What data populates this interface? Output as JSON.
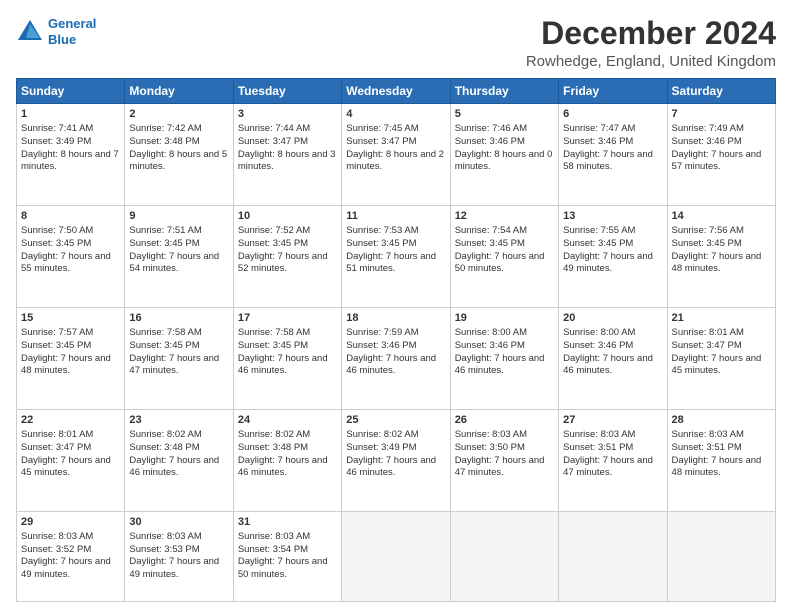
{
  "logo": {
    "line1": "General",
    "line2": "Blue"
  },
  "title": "December 2024",
  "subtitle": "Rowhedge, England, United Kingdom",
  "days": [
    "Sunday",
    "Monday",
    "Tuesday",
    "Wednesday",
    "Thursday",
    "Friday",
    "Saturday"
  ],
  "weeks": [
    [
      {
        "day": "1",
        "sunrise": "Sunrise: 7:41 AM",
        "sunset": "Sunset: 3:49 PM",
        "daylight": "Daylight: 8 hours and 7 minutes."
      },
      {
        "day": "2",
        "sunrise": "Sunrise: 7:42 AM",
        "sunset": "Sunset: 3:48 PM",
        "daylight": "Daylight: 8 hours and 5 minutes."
      },
      {
        "day": "3",
        "sunrise": "Sunrise: 7:44 AM",
        "sunset": "Sunset: 3:47 PM",
        "daylight": "Daylight: 8 hours and 3 minutes."
      },
      {
        "day": "4",
        "sunrise": "Sunrise: 7:45 AM",
        "sunset": "Sunset: 3:47 PM",
        "daylight": "Daylight: 8 hours and 2 minutes."
      },
      {
        "day": "5",
        "sunrise": "Sunrise: 7:46 AM",
        "sunset": "Sunset: 3:46 PM",
        "daylight": "Daylight: 8 hours and 0 minutes."
      },
      {
        "day": "6",
        "sunrise": "Sunrise: 7:47 AM",
        "sunset": "Sunset: 3:46 PM",
        "daylight": "Daylight: 7 hours and 58 minutes."
      },
      {
        "day": "7",
        "sunrise": "Sunrise: 7:49 AM",
        "sunset": "Sunset: 3:46 PM",
        "daylight": "Daylight: 7 hours and 57 minutes."
      }
    ],
    [
      {
        "day": "8",
        "sunrise": "Sunrise: 7:50 AM",
        "sunset": "Sunset: 3:45 PM",
        "daylight": "Daylight: 7 hours and 55 minutes."
      },
      {
        "day": "9",
        "sunrise": "Sunrise: 7:51 AM",
        "sunset": "Sunset: 3:45 PM",
        "daylight": "Daylight: 7 hours and 54 minutes."
      },
      {
        "day": "10",
        "sunrise": "Sunrise: 7:52 AM",
        "sunset": "Sunset: 3:45 PM",
        "daylight": "Daylight: 7 hours and 52 minutes."
      },
      {
        "day": "11",
        "sunrise": "Sunrise: 7:53 AM",
        "sunset": "Sunset: 3:45 PM",
        "daylight": "Daylight: 7 hours and 51 minutes."
      },
      {
        "day": "12",
        "sunrise": "Sunrise: 7:54 AM",
        "sunset": "Sunset: 3:45 PM",
        "daylight": "Daylight: 7 hours and 50 minutes."
      },
      {
        "day": "13",
        "sunrise": "Sunrise: 7:55 AM",
        "sunset": "Sunset: 3:45 PM",
        "daylight": "Daylight: 7 hours and 49 minutes."
      },
      {
        "day": "14",
        "sunrise": "Sunrise: 7:56 AM",
        "sunset": "Sunset: 3:45 PM",
        "daylight": "Daylight: 7 hours and 48 minutes."
      }
    ],
    [
      {
        "day": "15",
        "sunrise": "Sunrise: 7:57 AM",
        "sunset": "Sunset: 3:45 PM",
        "daylight": "Daylight: 7 hours and 48 minutes."
      },
      {
        "day": "16",
        "sunrise": "Sunrise: 7:58 AM",
        "sunset": "Sunset: 3:45 PM",
        "daylight": "Daylight: 7 hours and 47 minutes."
      },
      {
        "day": "17",
        "sunrise": "Sunrise: 7:58 AM",
        "sunset": "Sunset: 3:45 PM",
        "daylight": "Daylight: 7 hours and 46 minutes."
      },
      {
        "day": "18",
        "sunrise": "Sunrise: 7:59 AM",
        "sunset": "Sunset: 3:46 PM",
        "daylight": "Daylight: 7 hours and 46 minutes."
      },
      {
        "day": "19",
        "sunrise": "Sunrise: 8:00 AM",
        "sunset": "Sunset: 3:46 PM",
        "daylight": "Daylight: 7 hours and 46 minutes."
      },
      {
        "day": "20",
        "sunrise": "Sunrise: 8:00 AM",
        "sunset": "Sunset: 3:46 PM",
        "daylight": "Daylight: 7 hours and 46 minutes."
      },
      {
        "day": "21",
        "sunrise": "Sunrise: 8:01 AM",
        "sunset": "Sunset: 3:47 PM",
        "daylight": "Daylight: 7 hours and 45 minutes."
      }
    ],
    [
      {
        "day": "22",
        "sunrise": "Sunrise: 8:01 AM",
        "sunset": "Sunset: 3:47 PM",
        "daylight": "Daylight: 7 hours and 45 minutes."
      },
      {
        "day": "23",
        "sunrise": "Sunrise: 8:02 AM",
        "sunset": "Sunset: 3:48 PM",
        "daylight": "Daylight: 7 hours and 46 minutes."
      },
      {
        "day": "24",
        "sunrise": "Sunrise: 8:02 AM",
        "sunset": "Sunset: 3:48 PM",
        "daylight": "Daylight: 7 hours and 46 minutes."
      },
      {
        "day": "25",
        "sunrise": "Sunrise: 8:02 AM",
        "sunset": "Sunset: 3:49 PM",
        "daylight": "Daylight: 7 hours and 46 minutes."
      },
      {
        "day": "26",
        "sunrise": "Sunrise: 8:03 AM",
        "sunset": "Sunset: 3:50 PM",
        "daylight": "Daylight: 7 hours and 47 minutes."
      },
      {
        "day": "27",
        "sunrise": "Sunrise: 8:03 AM",
        "sunset": "Sunset: 3:51 PM",
        "daylight": "Daylight: 7 hours and 47 minutes."
      },
      {
        "day": "28",
        "sunrise": "Sunrise: 8:03 AM",
        "sunset": "Sunset: 3:51 PM",
        "daylight": "Daylight: 7 hours and 48 minutes."
      }
    ],
    [
      {
        "day": "29",
        "sunrise": "Sunrise: 8:03 AM",
        "sunset": "Sunset: 3:52 PM",
        "daylight": "Daylight: 7 hours and 49 minutes."
      },
      {
        "day": "30",
        "sunrise": "Sunrise: 8:03 AM",
        "sunset": "Sunset: 3:53 PM",
        "daylight": "Daylight: 7 hours and 49 minutes."
      },
      {
        "day": "31",
        "sunrise": "Sunrise: 8:03 AM",
        "sunset": "Sunset: 3:54 PM",
        "daylight": "Daylight: 7 hours and 50 minutes."
      },
      null,
      null,
      null,
      null
    ]
  ]
}
